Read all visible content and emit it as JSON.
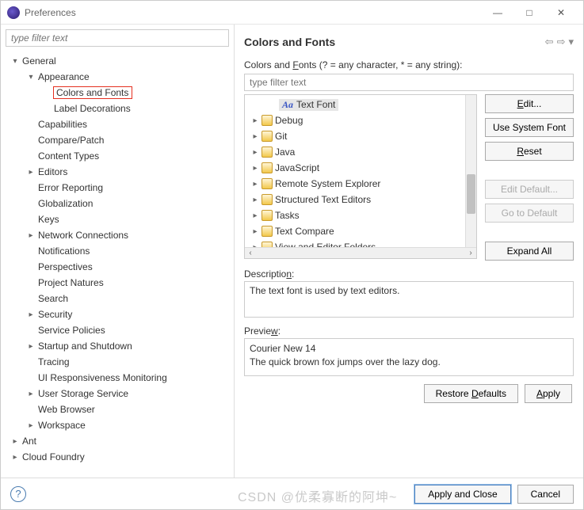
{
  "window": {
    "title": "Preferences"
  },
  "leftFilter": {
    "placeholder": "type filter text"
  },
  "tree": {
    "items": [
      {
        "ind": 0,
        "tw": "▾",
        "label": "General"
      },
      {
        "ind": 1,
        "tw": "▾",
        "label": "Appearance"
      },
      {
        "ind": 2,
        "tw": "",
        "label": "Colors and Fonts",
        "hl": true
      },
      {
        "ind": 2,
        "tw": "",
        "label": "Label Decorations"
      },
      {
        "ind": 1,
        "tw": "",
        "label": "Capabilities"
      },
      {
        "ind": 1,
        "tw": "",
        "label": "Compare/Patch"
      },
      {
        "ind": 1,
        "tw": "",
        "label": "Content Types"
      },
      {
        "ind": 1,
        "tw": "▸",
        "label": "Editors"
      },
      {
        "ind": 1,
        "tw": "",
        "label": "Error Reporting"
      },
      {
        "ind": 1,
        "tw": "",
        "label": "Globalization"
      },
      {
        "ind": 1,
        "tw": "",
        "label": "Keys"
      },
      {
        "ind": 1,
        "tw": "▸",
        "label": "Network Connections"
      },
      {
        "ind": 1,
        "tw": "",
        "label": "Notifications"
      },
      {
        "ind": 1,
        "tw": "",
        "label": "Perspectives"
      },
      {
        "ind": 1,
        "tw": "",
        "label": "Project Natures"
      },
      {
        "ind": 1,
        "tw": "",
        "label": "Search"
      },
      {
        "ind": 1,
        "tw": "▸",
        "label": "Security"
      },
      {
        "ind": 1,
        "tw": "",
        "label": "Service Policies"
      },
      {
        "ind": 1,
        "tw": "▸",
        "label": "Startup and Shutdown"
      },
      {
        "ind": 1,
        "tw": "",
        "label": "Tracing"
      },
      {
        "ind": 1,
        "tw": "",
        "label": "UI Responsiveness Monitoring"
      },
      {
        "ind": 1,
        "tw": "▸",
        "label": "User Storage Service"
      },
      {
        "ind": 1,
        "tw": "",
        "label": "Web Browser"
      },
      {
        "ind": 1,
        "tw": "▸",
        "label": "Workspace"
      },
      {
        "ind": 0,
        "tw": "▸",
        "label": "Ant"
      },
      {
        "ind": 0,
        "tw": "▸",
        "label": "Cloud Foundry"
      }
    ]
  },
  "right": {
    "title": "Colors and Fonts",
    "hint_pre": "Colors and ",
    "hint_u": "F",
    "hint_post": "onts (? = any character, * = any string):",
    "filterPlaceholder": "type filter text",
    "selected": "Text Font",
    "items": [
      {
        "label": "Debug"
      },
      {
        "label": "Git"
      },
      {
        "label": "Java"
      },
      {
        "label": "JavaScript"
      },
      {
        "label": "Remote System Explorer"
      },
      {
        "label": "Structured Text Editors"
      },
      {
        "label": "Tasks"
      },
      {
        "label": "Text Compare"
      },
      {
        "label": "View and Editor Folders"
      }
    ],
    "buttons": {
      "edit_pre": "",
      "edit_u": "E",
      "edit_post": "dit...",
      "use": "Use System Font",
      "reset_u": "R",
      "reset_post": "eset",
      "editDefault": "Edit Default...",
      "goDefault": "Go to Default",
      "expand": "Expand All"
    },
    "descLabel_pre": "Descriptio",
    "descLabel_u": "n",
    "descLabel_post": ":",
    "desc": "The text font is used by text editors.",
    "previewLabel_pre": "Previe",
    "previewLabel_u": "w",
    "previewLabel_post": ":",
    "preview1": "Courier New 14",
    "preview2": "The quick brown fox jumps over the lazy dog.",
    "restore_pre": "Restore ",
    "restore_u": "D",
    "restore_post": "efaults",
    "apply_u": "A",
    "apply_post": "pply"
  },
  "footer": {
    "applyClose": "Apply and Close",
    "cancel": "Cancel"
  },
  "watermark": "CSDN @优柔寡断的阿坤~"
}
